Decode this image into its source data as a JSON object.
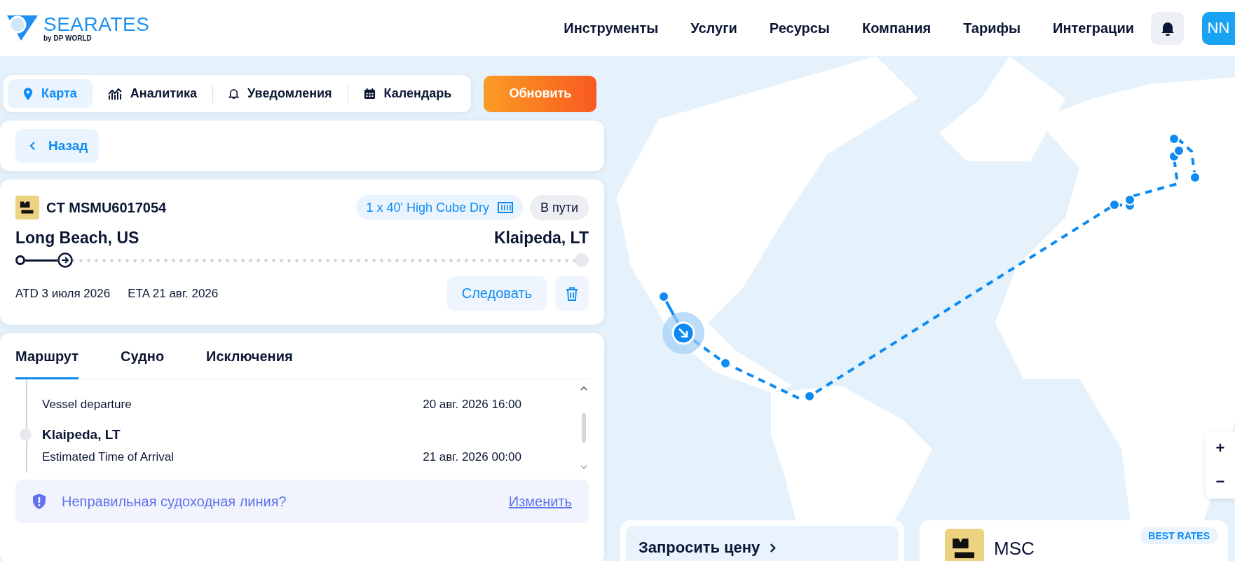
{
  "header": {
    "logo": {
      "name": "SEARATES",
      "tagline": "by DP WORLD"
    },
    "nav": [
      "Инструменты",
      "Услуги",
      "Ресурсы",
      "Компания",
      "Тарифы",
      "Интеграции"
    ],
    "avatar": "NN"
  },
  "view_tabs": [
    {
      "label": "Карта",
      "selected": true
    },
    {
      "label": "Аналитика",
      "selected": false
    },
    {
      "label": "Уведомления",
      "selected": false
    },
    {
      "label": "Календарь",
      "selected": false
    }
  ],
  "update_button": "Обновить",
  "back_button": "Назад",
  "shipment": {
    "id": "CT MSMU6017054",
    "container": "1 x 40' High Cube Dry",
    "status": "В пути",
    "origin": "Long Beach, US",
    "destination": "Klaipeda, LT",
    "level": 0.1,
    "atd": "ATD 3 июля 2026",
    "eta": "ETA 21 авг. 2026",
    "follow_button": "Следовать"
  },
  "detail_tabs": [
    {
      "label": "Маршрут",
      "selected": true
    },
    {
      "label": "Судно",
      "selected": false
    },
    {
      "label": "Исключения",
      "selected": false
    }
  ],
  "events": [
    {
      "kind": "event",
      "label": "Vessel departure",
      "time": "20 авг. 2026 16:00"
    },
    {
      "kind": "location",
      "label": "Klaipeda, LT"
    },
    {
      "kind": "event",
      "label": "Estimated Time of Arrival",
      "time": "21 авг. 2026 00:00"
    }
  ],
  "carrier_notice": {
    "text": "Неправильная судоходная линия?",
    "link": "Изменить"
  },
  "map": {
    "zoom_in": "+",
    "zoom_out": "−"
  },
  "quote_card": {
    "title": "Запросить цену"
  },
  "rate_card": {
    "badge": "BEST RATES",
    "carrier": "MSC"
  }
}
